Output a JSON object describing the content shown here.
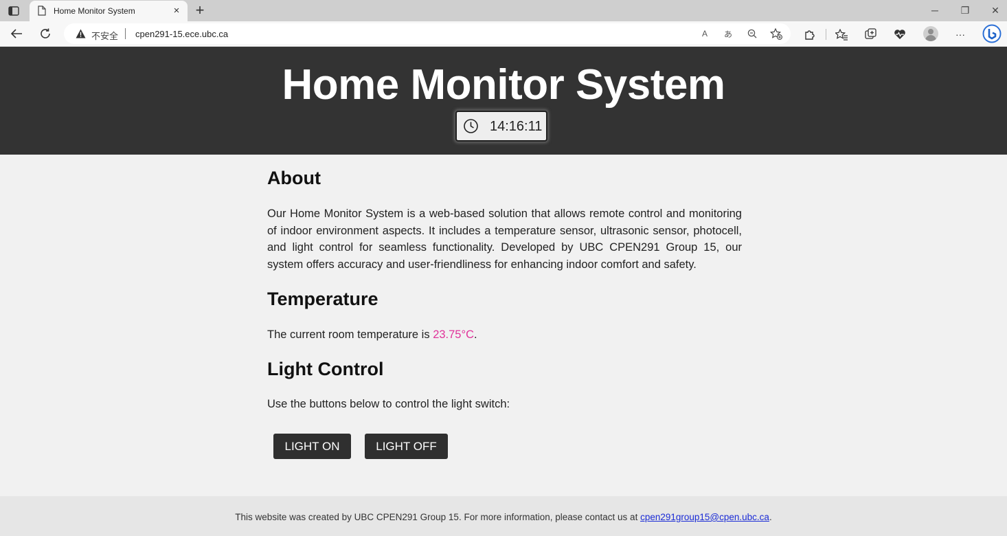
{
  "browser": {
    "tab_title": "Home Monitor System",
    "tab_close": "×",
    "new_tab": "+",
    "security_label": "不安全",
    "url": "cpen291-15.ece.ubc.ca",
    "window_controls": {
      "minimize": "─",
      "restore": "❐",
      "close": "✕"
    },
    "toolbar_more": "···",
    "read_aloud": "A",
    "translate": "あ"
  },
  "header": {
    "title": "Home Monitor System",
    "clock_time": "14:16:11"
  },
  "about": {
    "heading": "About",
    "text": "Our Home Monitor System is a web-based solution that allows remote control and monitoring of indoor environment aspects. It includes a temperature sensor, ultrasonic sensor, photocell, and light control for seamless functionality. Developed by UBC CPEN291 Group 15, our system offers accuracy and user-friendliness for enhancing indoor comfort and safety."
  },
  "temperature": {
    "heading": "Temperature",
    "prefix": "The current room temperature is ",
    "value": "23.75°C",
    "suffix": "."
  },
  "light_control": {
    "heading": "Light Control",
    "instructions": "Use the buttons below to control the light switch:",
    "on_label": "LIGHT ON",
    "off_label": "LIGHT OFF"
  },
  "footer": {
    "text": "This website was created by UBC CPEN291 Group 15. For more information, please contact us at ",
    "email": "cpen291group15@cpen.ubc.ca",
    "end": "."
  },
  "colors": {
    "header_bg": "#333333",
    "temperature_value": "#e0339a",
    "link": "#1a2bd6",
    "button_bg": "#2f2f2f"
  }
}
